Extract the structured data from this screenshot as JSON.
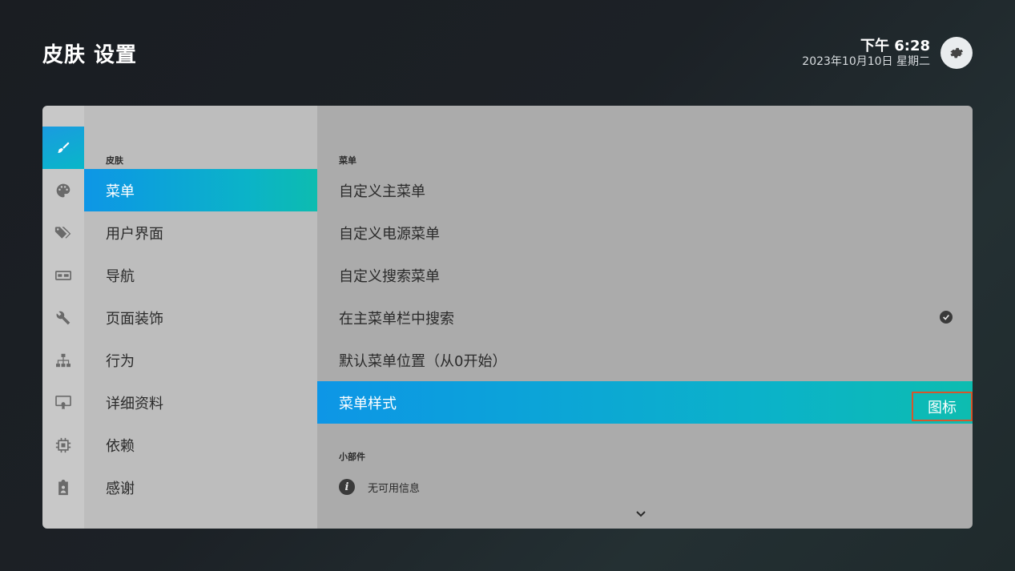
{
  "header": {
    "title": "皮肤 设置",
    "time": "下午 6:28",
    "date": "2023年10月10日 星期二",
    "settings_icon": "gear-icon"
  },
  "iconbar": {
    "icons": [
      "brush-icon",
      "palette-icon",
      "tags-icon",
      "display-icon",
      "wrench-icon",
      "sitemap-icon",
      "certificate-icon",
      "chip-icon",
      "badge-icon"
    ],
    "active_index": 0
  },
  "categories": {
    "section_label": "皮肤",
    "items": [
      "菜单",
      "用户界面",
      "导航",
      "页面装饰",
      "行为",
      "详细资料",
      "依赖",
      "感谢"
    ],
    "selected_index": 0
  },
  "content": {
    "section_menu": "菜单",
    "items": [
      {
        "label": "自定义主菜单"
      },
      {
        "label": "自定义电源菜单"
      },
      {
        "label": "自定义搜索菜单"
      },
      {
        "label": "在主菜单栏中搜索",
        "checked": true
      },
      {
        "label": "默认菜单位置（从0开始）"
      },
      {
        "label": "菜单样式",
        "value": "图标"
      }
    ],
    "selected_index": 5,
    "section_widgets": "小部件",
    "info_text": "无可用信息",
    "info_icon": "info-icon",
    "more_icon": "chevron-down-icon"
  },
  "colors": {
    "accent_start": "#0d96e6",
    "accent_end": "#0dbcb0",
    "highlight_border": "#d5562b"
  }
}
